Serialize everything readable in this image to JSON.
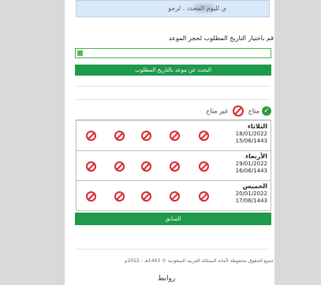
{
  "info": {
    "text": "ي لليوم المحدد . لرجو"
  },
  "form": {
    "instruction": "قم باختيار التاريخ المطلوب لحجز الموعد",
    "search_button": "البحث عن موعد بالتاريخ المطلوب"
  },
  "legend": {
    "available": "متاح",
    "unavailable": "غير متاح"
  },
  "days": [
    {
      "name": "الثلاثاء",
      "gregorian": "18/01/2022",
      "hijri": "15/06/1443"
    },
    {
      "name": "الأربعاء",
      "gregorian": "19/01/2022",
      "hijri": "16/06/1443"
    },
    {
      "name": "الخميس",
      "gregorian": "20/01/2022",
      "hijri": "17/06/1443"
    }
  ],
  "prev_button": "السابق",
  "footer": {
    "copyright": "جميع الحقوق محفوظة لأمانة المملكة العربية السعودية © 1443هـ - 2022م",
    "links": "روابط"
  },
  "icons": {
    "available": "check-circle-icon",
    "unavailable": "no-entry-icon"
  },
  "colors": {
    "primary": "#1f9a4c",
    "danger": "#d9282f",
    "info_bg": "#d9e9f8"
  }
}
